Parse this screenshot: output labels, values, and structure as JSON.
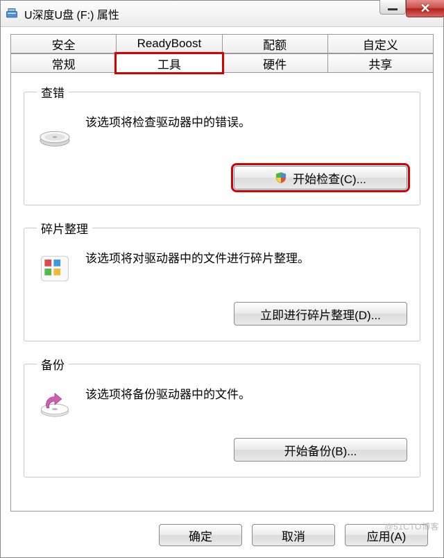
{
  "window": {
    "title": "U深度U盘 (F:) 属性"
  },
  "tabs": {
    "row1": [
      "安全",
      "ReadyBoost",
      "配额",
      "自定义"
    ],
    "row2": [
      "常规",
      "工具",
      "硬件",
      "共享"
    ],
    "active": "工具"
  },
  "sections": {
    "check": {
      "legend": "查错",
      "desc": "该选项将检查驱动器中的错误。",
      "button": "开始检查(C)..."
    },
    "defrag": {
      "legend": "碎片整理",
      "desc": "该选项将对驱动器中的文件进行碎片整理。",
      "button": "立即进行碎片整理(D)..."
    },
    "backup": {
      "legend": "备份",
      "desc": "该选项将备份驱动器中的文件。",
      "button": "开始备份(B)..."
    }
  },
  "buttons": {
    "ok": "确定",
    "cancel": "取消",
    "apply": "应用(A)"
  },
  "watermark": "@51CTO博客"
}
